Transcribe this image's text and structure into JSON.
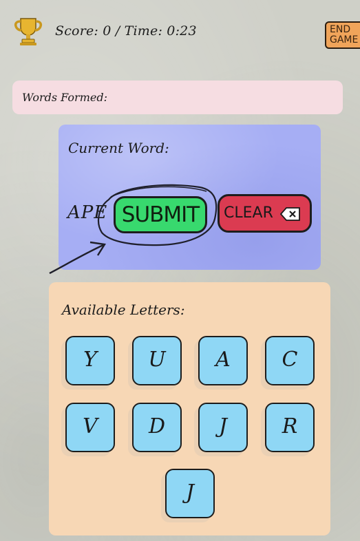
{
  "header": {
    "trophy_icon": "trophy-icon",
    "score_text": "Score: 0 / Time: 0:23",
    "end_game_line1": "END",
    "end_game_line2": "GAME"
  },
  "words_formed": {
    "label": "Words Formed:",
    "words": []
  },
  "current": {
    "label": "Current Word:",
    "word": "APE",
    "submit_label": "SUBMIT",
    "clear_label": "CLEAR",
    "clear_icon": "backspace-x-icon"
  },
  "letters": {
    "label": "Available Letters:",
    "tiles": [
      "Y",
      "U",
      "A",
      "C",
      "V",
      "D",
      "J",
      "R",
      "J"
    ]
  },
  "colors": {
    "words_panel": "#f6dde2",
    "current_panel": "#a6aef4",
    "letters_panel": "#f7d7b5",
    "tile": "#8fd7f5",
    "submit": "#38d96e",
    "clear": "#db3b51",
    "end_game": "#f0a45a"
  }
}
